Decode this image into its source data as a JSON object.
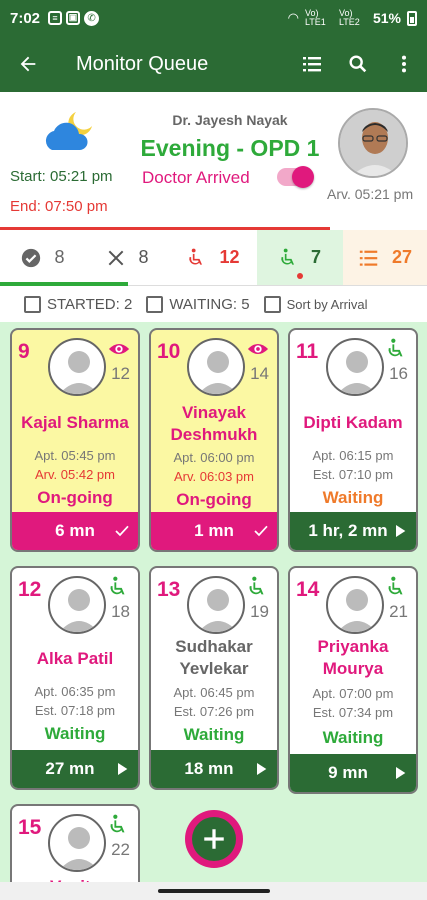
{
  "statusbar": {
    "time": "7:02",
    "battery": "51%",
    "net1": "Vo) LTE1",
    "net2": "Vo) LTE2"
  },
  "appbar": {
    "title": "Monitor Queue"
  },
  "header": {
    "doctor": "Dr. Jayesh  Nayak",
    "session": "Evening - OPD 1",
    "status": "Doctor Arrived",
    "start": "Start: 05:21 pm",
    "end": "End: 07:50 pm",
    "arrival": "Arv. 05:21 pm",
    "weather_icon": "moon-cloud-icon"
  },
  "tabs": [
    {
      "icon": "check-circle-icon",
      "count": "8",
      "color": "#555555"
    },
    {
      "icon": "close-icon",
      "count": "8",
      "color": "#555555"
    },
    {
      "icon": "wheelchair-icon",
      "count": "12",
      "color": "#e53935"
    },
    {
      "icon": "wheelchair-icon",
      "count": "7",
      "color": "#2b6b34"
    },
    {
      "icon": "list-icon",
      "count": "27",
      "color": "#ef7a2a"
    }
  ],
  "filters": {
    "started": "STARTED: 2",
    "waiting": "WAITING: 5",
    "sort": "Sort by Arrival"
  },
  "cards": [
    {
      "num": "9",
      "count": "12",
      "name1": "Kajal Sharma",
      "name2": "",
      "apt": "Apt. 05:45 pm",
      "arv": "Arv. 05:42 pm",
      "est": "",
      "state": "On-going",
      "time": "6 mn"
    },
    {
      "num": "10",
      "count": "14",
      "name1": "Vinayak",
      "name2": "Deshmukh",
      "apt": "Apt. 06:00 pm",
      "arv": "Arv. 06:03 pm",
      "est": "",
      "state": "On-going",
      "time": "1 mn"
    },
    {
      "num": "11",
      "count": "16",
      "name1": "Dipti Kadam",
      "name2": "",
      "apt": "Apt. 06:15 pm",
      "arv": "",
      "est": "Est. 07:10 pm",
      "state": "Waiting",
      "time": "1 hr, 2 mn"
    },
    {
      "num": "12",
      "count": "18",
      "name1": "Alka Patil",
      "name2": "",
      "apt": "Apt. 06:35 pm",
      "arv": "",
      "est": "Est. 07:18 pm",
      "state": "Waiting",
      "time": "27 mn"
    },
    {
      "num": "13",
      "count": "19",
      "name1": "Sudhakar",
      "name2": "Yevlekar",
      "apt": "Apt. 06:45 pm",
      "arv": "",
      "est": "Est. 07:26 pm",
      "state": "Waiting",
      "time": "18 mn"
    },
    {
      "num": "14",
      "count": "21",
      "name1": "Priyanka",
      "name2": "Mourya",
      "apt": "Apt. 07:00 pm",
      "arv": "",
      "est": "Est. 07:34 pm",
      "state": "Waiting",
      "time": "9 mn"
    },
    {
      "num": "15",
      "count": "22",
      "name1": "Vanita",
      "name2": "",
      "apt": "",
      "arv": "",
      "est": "",
      "state": "",
      "time": ""
    }
  ],
  "colors": {
    "primary": "#2b6b34",
    "accent": "#e0197d",
    "success": "#2eaa3a",
    "warning": "#ef7a2a",
    "danger": "#e53935"
  }
}
